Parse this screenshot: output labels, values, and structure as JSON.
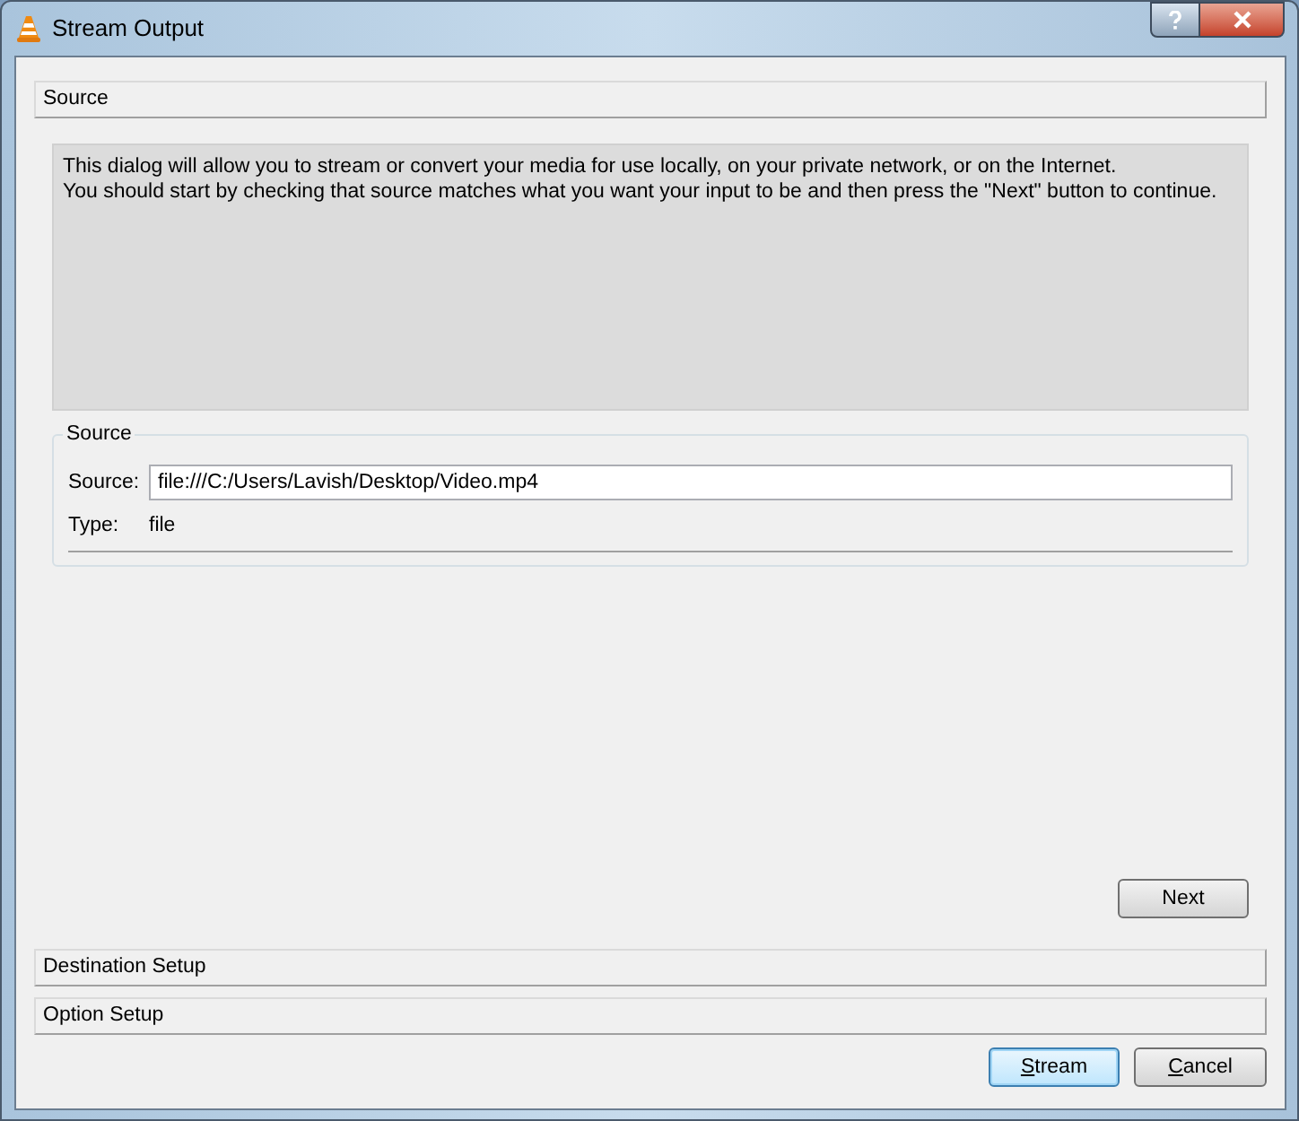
{
  "window": {
    "title": "Stream Output"
  },
  "sections": [
    {
      "title": "Source"
    },
    {
      "title": "Destination Setup"
    },
    {
      "title": "Option Setup"
    }
  ],
  "info_text": [
    "This dialog will allow you to stream or convert your media for use locally, on your private network, or on the Internet.",
    "You should start by checking that source matches what you want your input to be and then press the \"Next\" button to continue."
  ],
  "source_group": {
    "title": "Source",
    "source_label": "Source:",
    "source_value": "file:///C:/Users/Lavish/Desktop/Video.mp4",
    "type_label": "Type:",
    "type_value": "file"
  },
  "next_button": "Next",
  "buttons": [
    {
      "label": "Stream",
      "default": true
    },
    {
      "label": "Cancel",
      "default": false
    }
  ]
}
